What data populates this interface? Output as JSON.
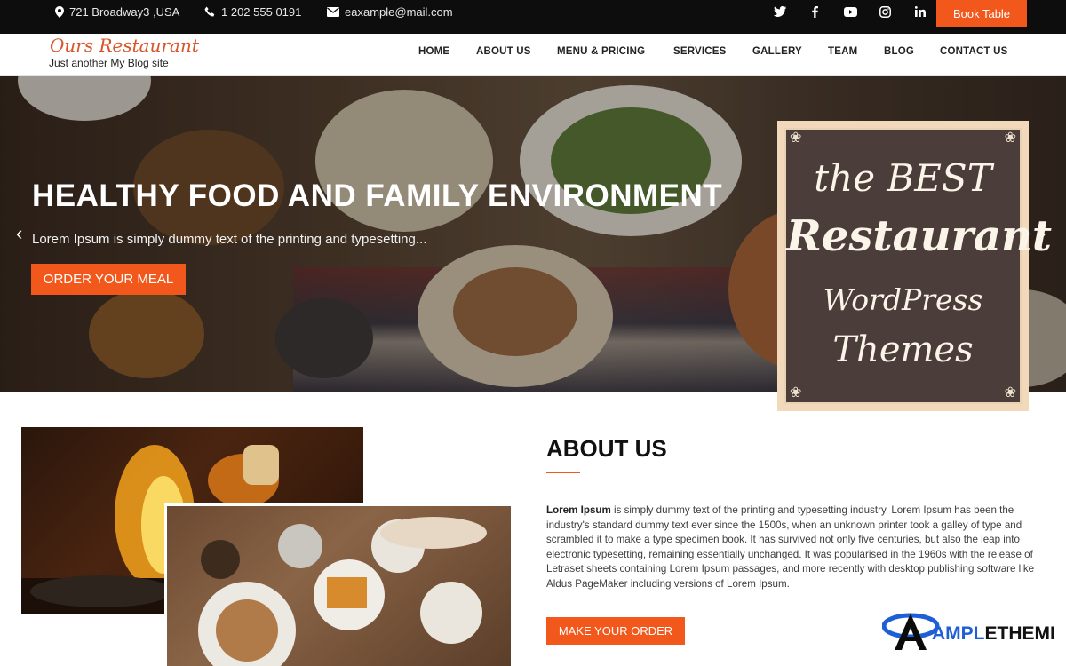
{
  "topbar": {
    "address": "721 Broadway3 ,USA",
    "phone": "1 202 555 0191",
    "email": "eaxample@mail.com",
    "social": [
      "twitter-icon",
      "facebook-icon",
      "youtube-icon",
      "instagram-icon",
      "linkedin-icon"
    ],
    "book_label": "Book Table"
  },
  "brand": {
    "name": "Ours Restaurant",
    "tagline": "Just another My Blog site"
  },
  "nav": [
    "HOME",
    "ABOUT US",
    "MENU & PRICING",
    "SERVICES",
    "GALLERY",
    "TEAM",
    "BLOG",
    "CONTACT US"
  ],
  "hero": {
    "title": "HEALTHY FOOD AND FAMILY ENVIRONMENT",
    "subtitle": "Lorem Ipsum is simply dummy text of the printing and typesetting...",
    "button": "ORDER YOUR MEAL"
  },
  "badge": {
    "line1": "the BEST",
    "line2": "Restaurant",
    "line3": "WordPress",
    "line4": "Themes"
  },
  "about": {
    "title": "ABOUT US",
    "lead": "Lorem Ipsum",
    "text": " is simply dummy text of the printing and typesetting industry. Lorem Ipsum has been the industry's standard dummy text ever since the 1500s, when an unknown printer took a galley of type and scrambled it to make a type specimen book. It has survived not only five centuries, but also the leap into electronic typesetting, remaining essentially unchanged. It was popularised in the 1960s with the release of Letraset sheets containing Lorem Ipsum passages, and more recently with desktop publishing software like Aldus PageMaker including versions of Lorem Ipsum.",
    "button": "MAKE YOUR ORDER"
  },
  "watermark": {
    "text": "AMPLETHEMES"
  },
  "colors": {
    "accent": "#f2581c",
    "topbar": "#0d0d0d",
    "board": "#4b3d3a",
    "board_frame": "#f3d9bc",
    "brand_name": "#d8552a"
  }
}
